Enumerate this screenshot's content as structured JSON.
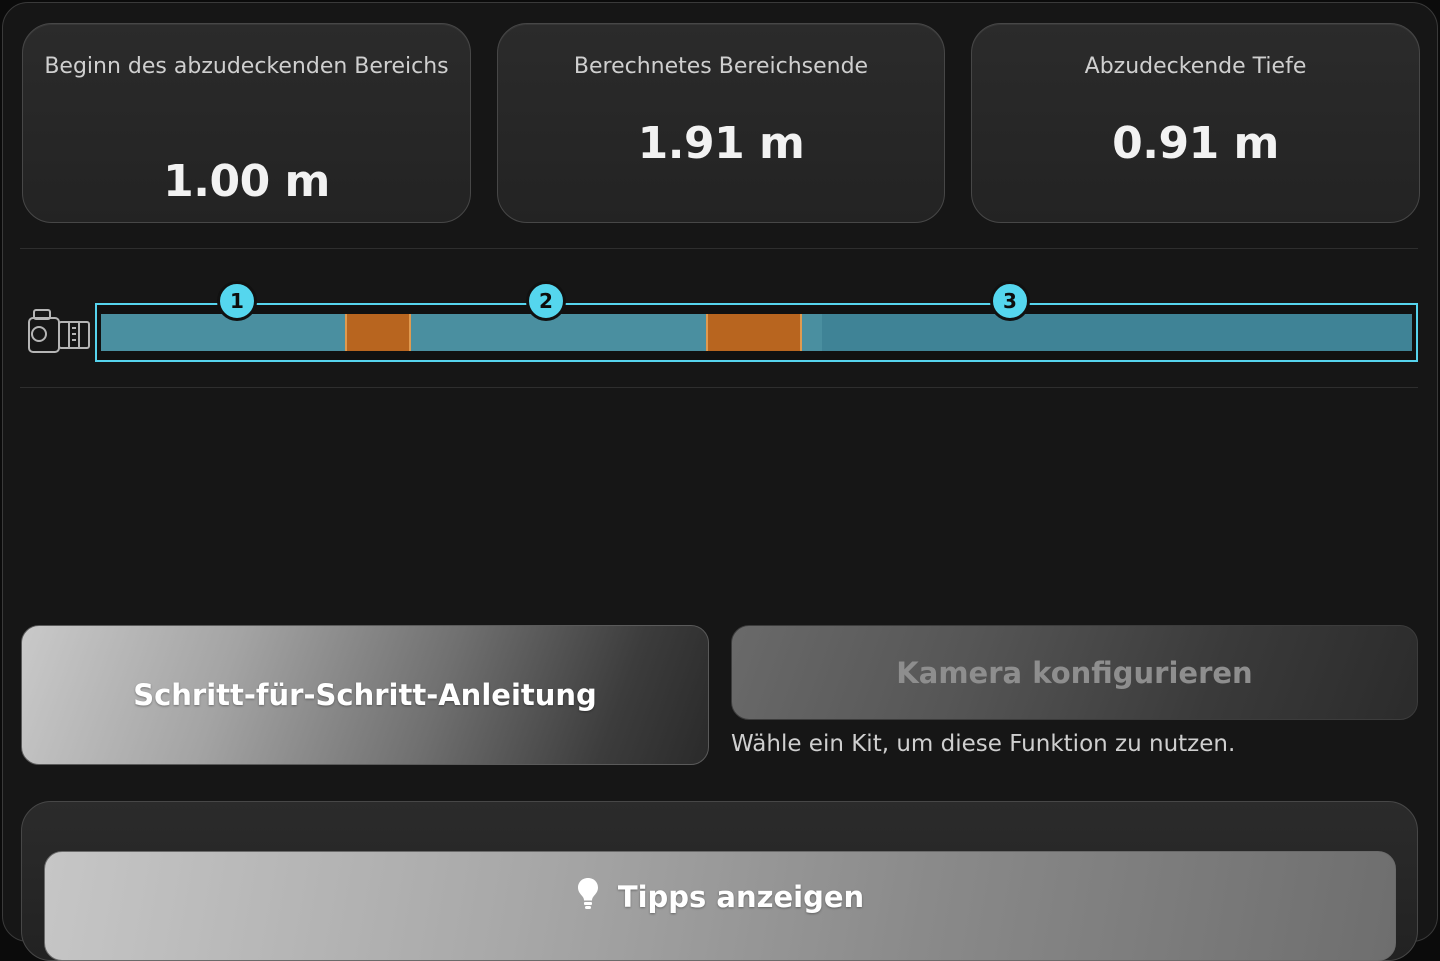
{
  "stats": {
    "start": {
      "label": "Beginn des abzudeckenden Bereichs",
      "value": "1.00 m"
    },
    "end": {
      "label": "Berechnetes Bereichsende",
      "value": "1.91 m"
    },
    "depth": {
      "label": "Abzudeckende Tiefe",
      "value": "0.91 m"
    }
  },
  "diagram": {
    "markers": [
      "1",
      "2",
      "3"
    ],
    "colors": {
      "track": "#4a8fa0",
      "outline": "#56d4ee",
      "segment": "#b8651f",
      "marker": "#55d6ee"
    },
    "icon": "camera-icon"
  },
  "buttons": {
    "guide_label": "Schritt-für-Schritt-Anleitung",
    "camera_label": "Kamera konfigurieren",
    "camera_hint": "Wähle ein Kit, um diese Funktion zu nutzen.",
    "tips_label": "Tipps anzeigen",
    "tips_icon": "lightbulb-icon"
  }
}
